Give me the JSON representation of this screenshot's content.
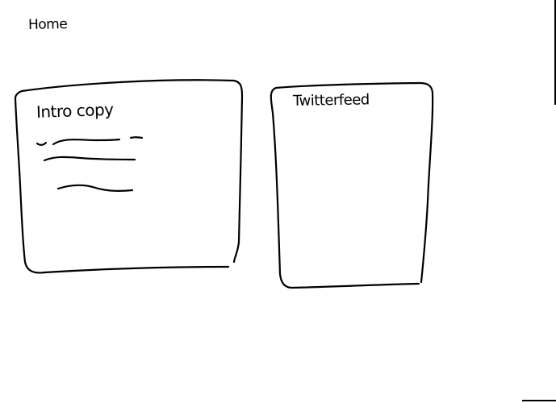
{
  "page": {
    "title": "Home"
  },
  "panels": {
    "intro": {
      "title": "Intro copy"
    },
    "twitter": {
      "title": "Twitterfeed"
    }
  },
  "colors": {
    "ink": "#000000",
    "paper": "#ffffff"
  }
}
